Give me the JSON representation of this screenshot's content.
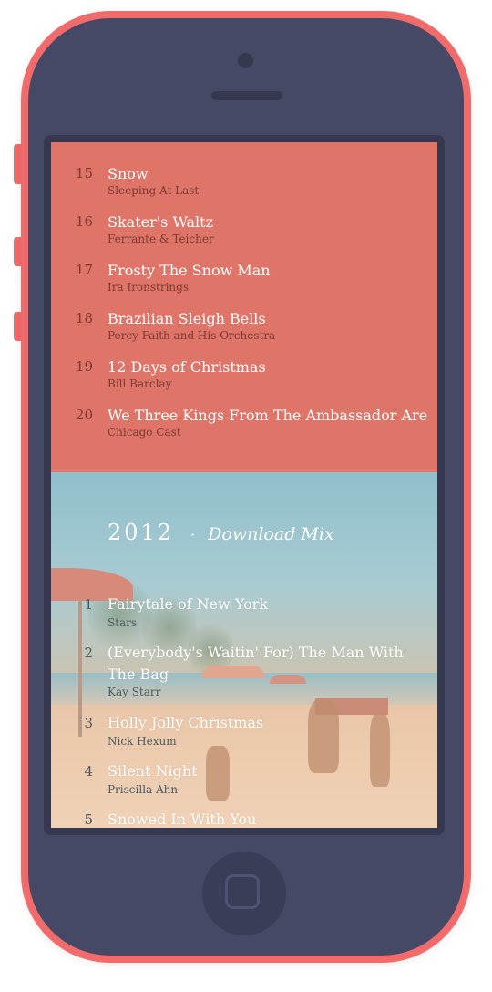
{
  "colors": {
    "phone_frame": "#f26b6b",
    "phone_body": "#454966",
    "tracklist_background": "#df7468",
    "track_title": "#ffffff",
    "track_artist": "#7a3a34"
  },
  "icons": {
    "camera": "camera-icon",
    "speaker": "speaker-icon",
    "home": "home-button-icon"
  },
  "tracklist": [
    {
      "number": "15",
      "title": "Snow",
      "artist": "Sleeping At Last"
    },
    {
      "number": "16",
      "title": "Skater's Waltz",
      "artist": "Ferrante & Teicher"
    },
    {
      "number": "17",
      "title": "Frosty The Snow Man",
      "artist": "Ira Ironstrings"
    },
    {
      "number": "18",
      "title": "Brazilian Sleigh Bells",
      "artist": "Percy Faith and His Orchestra"
    },
    {
      "number": "19",
      "title": "12 Days of Christmas",
      "artist": "Bill Barclay"
    },
    {
      "number": "20",
      "title": "We Three Kings From The Ambassador Are",
      "artist": "Chicago Cast"
    }
  ],
  "mix": {
    "year": "2012",
    "separator": "·",
    "download_label": "Download Mix",
    "tracks": [
      {
        "number": "1",
        "title": "Fairytale of New York",
        "artist": "Stars"
      },
      {
        "number": "2",
        "title": "(Everybody's Waitin' For) The Man With The Bag",
        "artist": "Kay Starr"
      },
      {
        "number": "3",
        "title": "Holly Jolly Christmas",
        "artist": "Nick Hexum"
      },
      {
        "number": "4",
        "title": "Silent Night",
        "artist": "Priscilla Ahn"
      },
      {
        "number": "5",
        "title": "Snowed In With You",
        "artist": ""
      }
    ]
  }
}
